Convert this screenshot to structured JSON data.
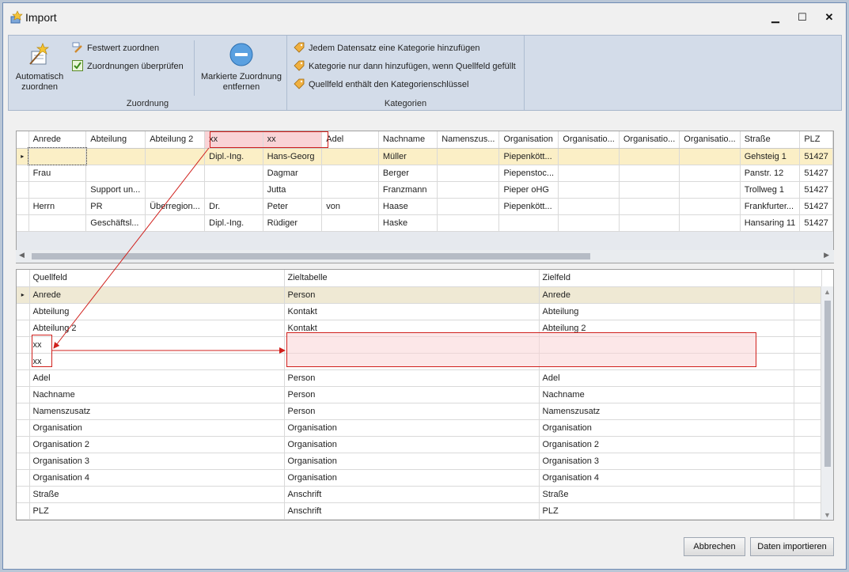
{
  "window": {
    "title": "Import",
    "min": "▁",
    "max": "☐",
    "close": "✕"
  },
  "ribbon": {
    "auto_assign": "Automatisch zuordnen",
    "fixed_value": "Festwert zuordnen",
    "check_assign": "Zuordnungen überprüfen",
    "remove_assign": "Markierte Zuordnung entfernen",
    "group1_label": "Zuordnung",
    "cat1": "Jedem Datensatz eine Kategorie hinzufügen",
    "cat2": "Kategorie nur dann hinzufügen, wenn Quellfeld gefüllt",
    "cat3": "Quellfeld enthält den Kategorienschlüssel",
    "group2_label": "Kategorien"
  },
  "source_grid": {
    "headers": [
      "Anrede",
      "Abteilung",
      "Abteilung 2",
      "xx",
      "xx",
      "Adel",
      "Nachname",
      "Namenszus...",
      "Organisation",
      "Organisatio...",
      "Organisatio...",
      "Organisatio...",
      "Straße",
      "PLZ"
    ],
    "rows": [
      [
        "",
        "",
        "",
        "Dipl.-Ing.",
        "Hans-Georg",
        "",
        "Müller",
        "",
        "Piepenkött...",
        "",
        "",
        "",
        "Gehsteig 1",
        "51427"
      ],
      [
        "Frau",
        "",
        "",
        "",
        "Dagmar",
        "",
        "Berger",
        "",
        "Piepenstoc...",
        "",
        "",
        "",
        "Panstr. 12",
        "51427"
      ],
      [
        "",
        "Support un...",
        "",
        "",
        "Jutta",
        "",
        "Franzmann",
        "",
        "Pieper oHG",
        "",
        "",
        "",
        "Trollweg 1",
        "51427"
      ],
      [
        "Herrn",
        "PR",
        "Überregion...",
        "Dr.",
        "Peter",
        "von",
        "Haase",
        "",
        "Piepenkött...",
        "",
        "",
        "",
        "Frankfurter...",
        "51427"
      ],
      [
        "",
        "Geschäftsl...",
        "",
        "Dipl.-Ing.",
        "Rüdiger",
        "",
        "Haske",
        "",
        "",
        "",
        "",
        "",
        "Hansaring 11",
        "51427"
      ]
    ]
  },
  "mapping_grid": {
    "headers": [
      "Quellfeld",
      "Zieltabelle",
      "Zielfeld"
    ],
    "rows": [
      [
        "Anrede",
        "Person",
        "Anrede"
      ],
      [
        "Abteilung",
        "Kontakt",
        "Abteilung"
      ],
      [
        "Abteilung 2",
        "Kontakt",
        "Abteilung 2"
      ],
      [
        "xx",
        "",
        ""
      ],
      [
        "xx",
        "",
        ""
      ],
      [
        "Adel",
        "Person",
        "Adel"
      ],
      [
        "Nachname",
        "Person",
        "Nachname"
      ],
      [
        "Namenszusatz",
        "Person",
        "Namenszusatz"
      ],
      [
        "Organisation",
        "Organisation",
        "Organisation"
      ],
      [
        "Organisation 2",
        "Organisation",
        "Organisation 2"
      ],
      [
        "Organisation 3",
        "Organisation",
        "Organisation 3"
      ],
      [
        "Organisation 4",
        "Organisation",
        "Organisation 4"
      ],
      [
        "Straße",
        "Anschrift",
        "Straße"
      ],
      [
        "PLZ",
        "Anschrift",
        "PLZ"
      ]
    ]
  },
  "footer": {
    "cancel": "Abbrechen",
    "import": "Daten importieren"
  },
  "colors": {
    "highlight": "#f9d3d6",
    "annotation_red": "#d0201c",
    "selected_row": "#fbefc6"
  }
}
